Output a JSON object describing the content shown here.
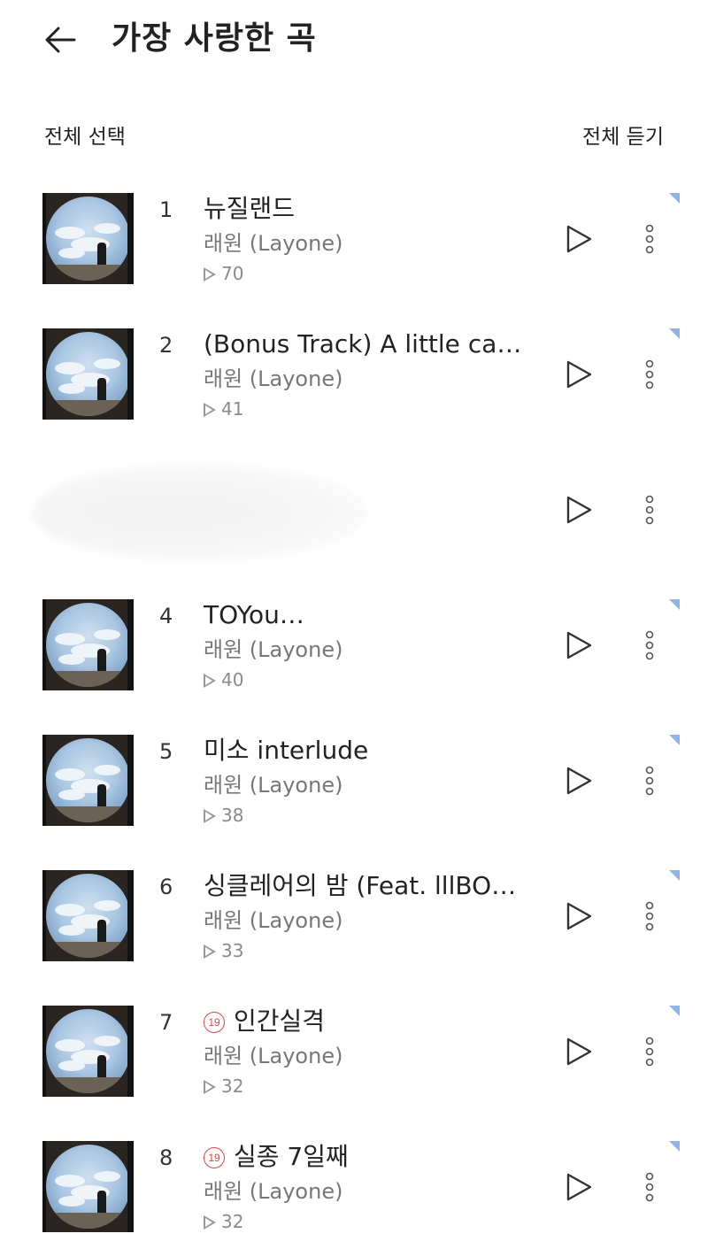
{
  "header": {
    "title": "가장 사랑한 곡"
  },
  "actions": {
    "select_all": "전체 선택",
    "play_all": "전체 듣기"
  },
  "colors": {
    "explicit_badge": "#e0463d",
    "corner_mark": "#8fb4e8"
  },
  "songs": [
    {
      "number": "1",
      "title": "뉴질랜드",
      "artist": "래원 (Layone)",
      "plays": "70",
      "explicit_badge": ""
    },
    {
      "number": "2",
      "title": "(Bonus Track) A little ca…",
      "artist": "래원 (Layone)",
      "plays": "41",
      "explicit_badge": ""
    },
    {
      "number": "",
      "title": "",
      "artist": "",
      "plays": "",
      "explicit_badge": ""
    },
    {
      "number": "4",
      "title": "TOYou…",
      "artist": "래원 (Layone)",
      "plays": "40",
      "explicit_badge": ""
    },
    {
      "number": "5",
      "title": "미소 interlude",
      "artist": "래원 (Layone)",
      "plays": "38",
      "explicit_badge": ""
    },
    {
      "number": "6",
      "title": "싱클레어의 밤 (Feat. lllBO…",
      "artist": "래원 (Layone)",
      "plays": "33",
      "explicit_badge": ""
    },
    {
      "number": "7",
      "title": "인간실격",
      "artist": "래원 (Layone)",
      "plays": "32",
      "explicit_badge": "19"
    },
    {
      "number": "8",
      "title": "실종 7일째",
      "artist": "래원 (Layone)",
      "plays": "32",
      "explicit_badge": "19"
    }
  ]
}
